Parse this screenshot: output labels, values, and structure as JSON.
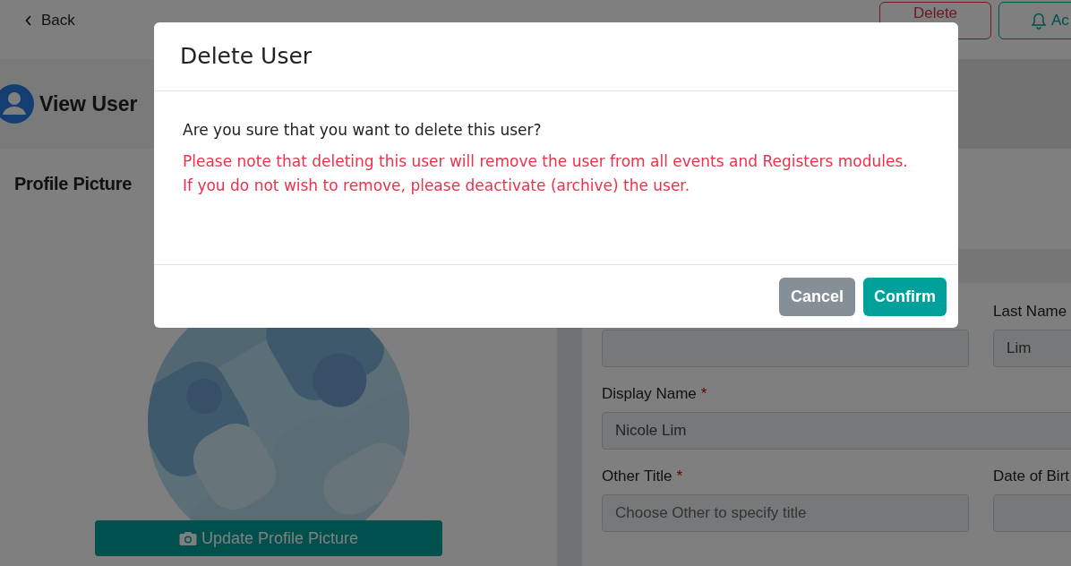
{
  "top_bar": {
    "back_label": "Back",
    "buttons": [
      {
        "label": "Delete",
        "kind": "danger"
      },
      {
        "label": "Ac",
        "kind": "notify"
      }
    ]
  },
  "page_title": "View User",
  "profile": {
    "heading": "Profile Picture",
    "update_button": "Update Profile Picture"
  },
  "form": {
    "rows": [
      {
        "cells": [
          {
            "kind": "hidden"
          },
          {
            "kind": "input",
            "label": "Last Name",
            "value": "Lim"
          }
        ]
      },
      {
        "cells": [
          {
            "kind": "input",
            "label": "Display Name",
            "required_mark": "*",
            "value": "Nicole Lim"
          }
        ]
      },
      {
        "cells": [
          {
            "kind": "input",
            "label": "Other Title",
            "required_mark": "*",
            "placeholder": "Choose Other to specify title"
          },
          {
            "kind": "input",
            "label": "Date of Birt"
          }
        ]
      }
    ]
  },
  "dialog": {
    "title": "Delete User",
    "question": "Are you sure that you want to delete this user?",
    "warnings": [
      "Please note that deleting this user will remove the user from all events and Registers modules.",
      "If you do not wish to remove, please deactivate (archive) the user."
    ],
    "buttons": [
      {
        "label": "Cancel",
        "kind": "secondary"
      },
      {
        "label": "Confirm",
        "kind": "primary"
      }
    ]
  }
}
